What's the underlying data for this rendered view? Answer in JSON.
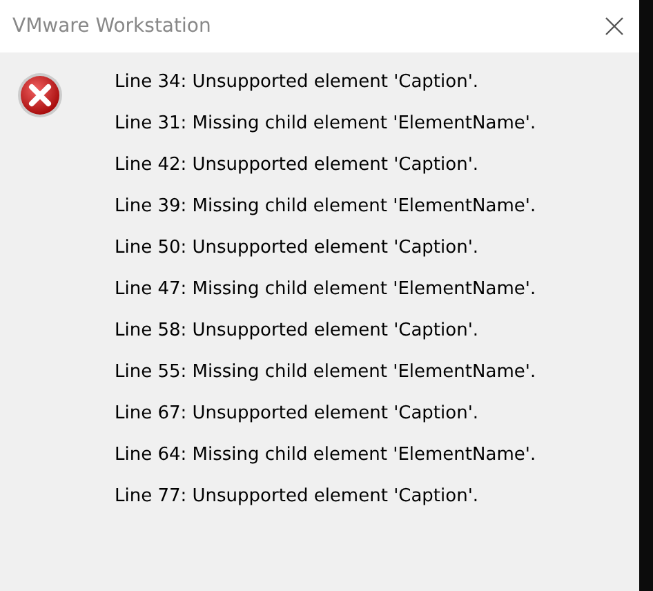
{
  "window": {
    "title": "VMware Workstation"
  },
  "dialog": {
    "messages": [
      "Line 34: Unsupported element 'Caption'.",
      "Line 31: Missing child element 'ElementName'.",
      "Line 42: Unsupported element 'Caption'.",
      "Line 39: Missing child element 'ElementName'.",
      "Line 50: Unsupported element 'Caption'.",
      "Line 47: Missing child element 'ElementName'.",
      "Line 58: Unsupported element 'Caption'.",
      "Line 55: Missing child element 'ElementName'.",
      "Line 67: Unsupported element 'Caption'.",
      "Line 64: Missing child element 'ElementName'.",
      "Line 77: Unsupported element 'Caption'."
    ]
  }
}
